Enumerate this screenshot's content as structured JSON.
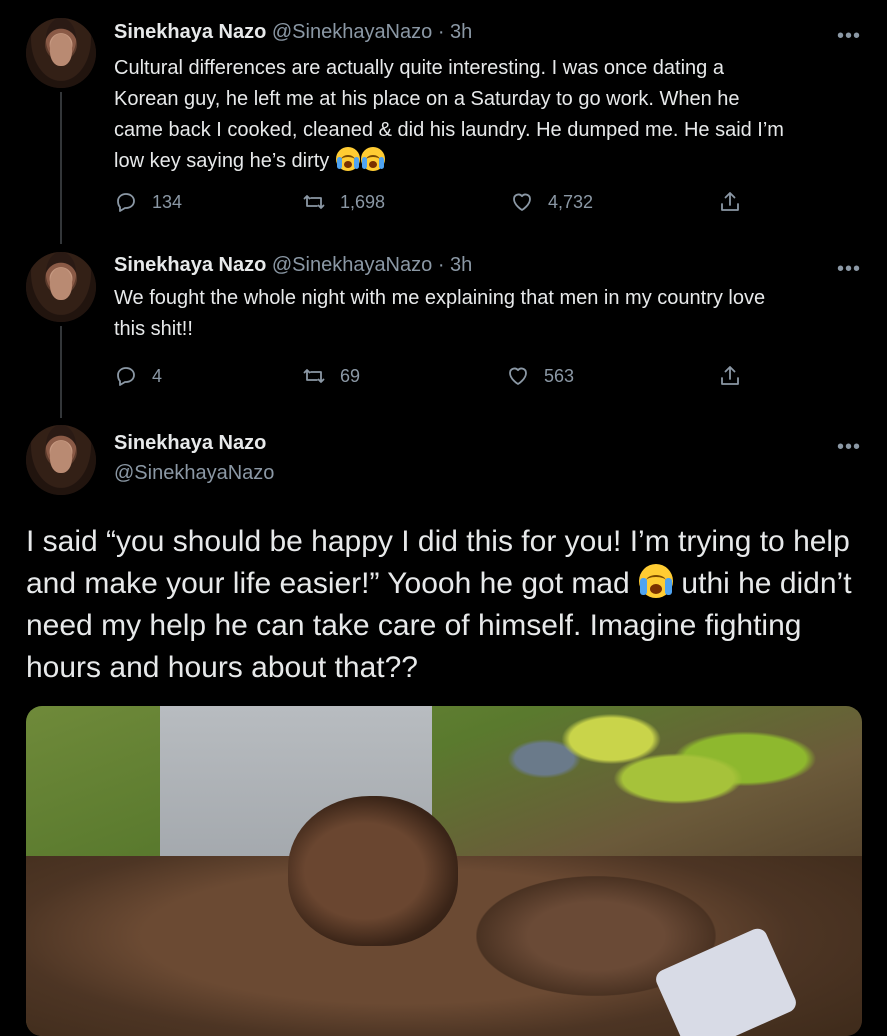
{
  "colors": {
    "background": "#000000",
    "text": "#e7e9ea",
    "muted": "#8b98a5"
  },
  "tweets": [
    {
      "name": "Sinekhaya Nazo",
      "handle": "@SinekhayaNazo",
      "time": "3h",
      "lines": [
        "Cultural differences are actually quite interesting. I was once dating a",
        "Korean guy, he left me at his place on a Saturday to go work. When he",
        "came back I cooked, cleaned & did his laundry. He dumped me. He said I’m",
        "low key saying he’s dirty"
      ],
      "emoji": "😭😭",
      "replies": "134",
      "retweets": "1,698",
      "likes": "4,732"
    },
    {
      "name": "Sinekhaya Nazo",
      "handle": "@SinekhayaNazo",
      "time": "3h",
      "lines": [
        "We fought the whole night with me explaining that men in my country love",
        "this shit!!"
      ],
      "replies": "4",
      "retweets": "69",
      "likes": "563"
    }
  ],
  "main_tweet": {
    "name": "Sinekhaya Nazo",
    "handle": "@SinekhayaNazo",
    "text_part1": "I said “you should be happy I did this for you! I’m trying to help and make your life easier!” Yoooh he got mad",
    "text_part2": "uthi he didn’t need my help he can take care of himself. Imagine fighting hours and hours about that??"
  },
  "more_label": "•••",
  "separator": "·"
}
